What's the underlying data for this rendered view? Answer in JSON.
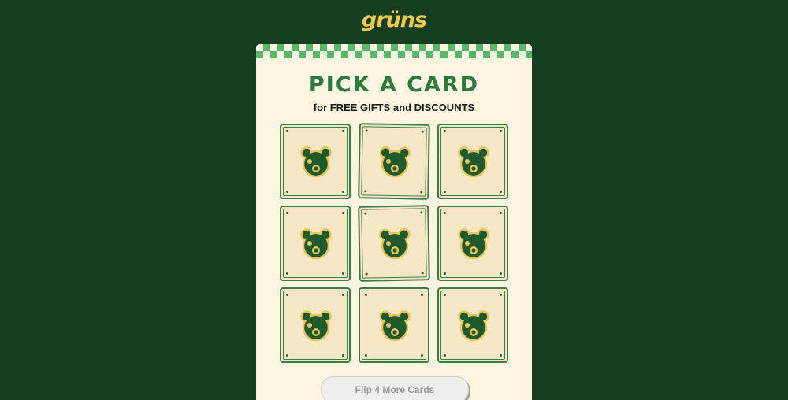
{
  "brand": {
    "logo_text": "grüns"
  },
  "game": {
    "title": "PICK A CARD",
    "subtitle": "for FREE GIFTS and DISCOUNTS",
    "cards": [
      {
        "icon": "bear-icon"
      },
      {
        "icon": "bear-icon"
      },
      {
        "icon": "bear-icon"
      },
      {
        "icon": "bear-icon"
      },
      {
        "icon": "bear-icon"
      },
      {
        "icon": "bear-icon"
      },
      {
        "icon": "bear-icon"
      },
      {
        "icon": "bear-icon"
      },
      {
        "icon": "bear-icon"
      }
    ],
    "flip_button_label": "Flip 4 More Cards"
  },
  "colors": {
    "background": "#163f22",
    "logo": "#f2c94c",
    "panel": "#fcf6e1",
    "checker": "#59b76c",
    "title": "#2c7a3f",
    "card_face": "#f6e8c6",
    "bear": "#1e5a2c",
    "bear_outline": "#e9c45a"
  }
}
